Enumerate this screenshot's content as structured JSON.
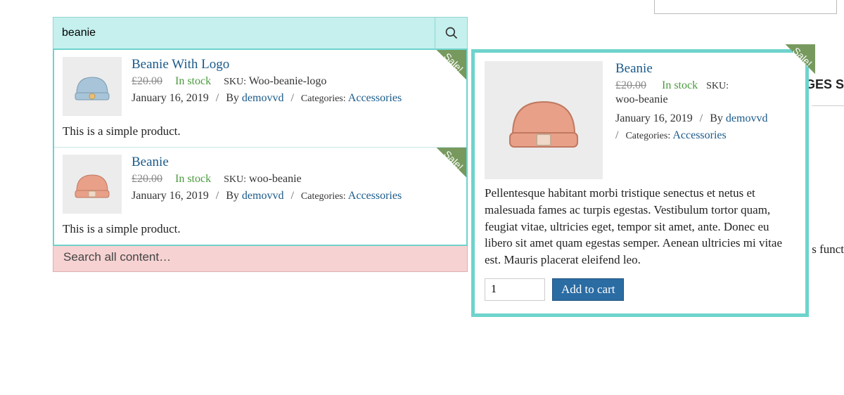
{
  "search": {
    "value": "beanie",
    "all_content_label": "Search all content…"
  },
  "results": [
    {
      "title": "Beanie With Logo",
      "old_price": "£20.00",
      "stock": "In stock",
      "sku_label": "SKU:",
      "sku": "Woo-beanie-logo",
      "date": "January 16, 2019",
      "by_label": "By",
      "author": "demovvd",
      "cat_label": "Categories:",
      "category": "Accessories",
      "excerpt": "This is a simple product.",
      "sale": "Sale!",
      "thumb_color": "blue"
    },
    {
      "title": "Beanie",
      "old_price": "£20.00",
      "stock": "In stock",
      "sku_label": "SKU:",
      "sku": "woo-beanie",
      "date": "January 16, 2019",
      "by_label": "By",
      "author": "demovvd",
      "cat_label": "Categories:",
      "category": "Accessories",
      "excerpt": "This is a simple product.",
      "sale": "Sale!",
      "thumb_color": "coral"
    }
  ],
  "preview": {
    "title": "Beanie",
    "old_price": "£20.00",
    "stock": "In stock",
    "sku_label": "SKU:",
    "sku": "woo-beanie",
    "date": "January 16, 2019",
    "by_label": "By",
    "author": "demovvd",
    "cat_label": "Categories:",
    "category": "Accessories",
    "description": "Pellentesque habitant morbi tristique senectus et netus et malesuada fames ac turpis egestas. Vestibulum tortor quam, feugiat vitae, ultricies eget, tempor sit amet, ante. Donec eu libero sit amet quam egestas semper. Aenean ultricies mi vitae est. Mauris placerat eleifend leo.",
    "qty": "1",
    "add_to_cart": "Add to cart",
    "sale": "Sale!"
  },
  "fragments": {
    "right1": "GES S",
    "right2": "s funct"
  }
}
